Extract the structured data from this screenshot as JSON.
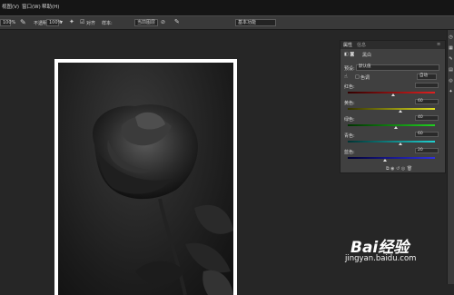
{
  "menubar": {
    "items": [
      "视图(V)",
      "窗口(W)",
      "帮助(H)"
    ]
  },
  "options_bar": {
    "zoom_value": "100%",
    "opacity_label": "不透明度:",
    "opacity_value": "100%",
    "flow_label": "流量:",
    "flow_value": "100%",
    "airbrush_label": "对齐",
    "sample_label": "样本:",
    "sample_value": "当前图层",
    "workspace_value": "基本功能"
  },
  "properties_panel": {
    "tabs": [
      "属性",
      "信息"
    ],
    "header_label": "黑白",
    "preset_label": "预设:",
    "preset_value": "默认值",
    "tint_label": "色调",
    "auto_label": "自动",
    "sliders": [
      {
        "label": "红色:",
        "value": "",
        "fill": 0.52
      },
      {
        "label": "黄色:",
        "value": "60",
        "fill": 0.6
      },
      {
        "label": "绿色:",
        "value": "40",
        "fill": 0.55
      },
      {
        "label": "青色:",
        "value": "60",
        "fill": 0.6
      },
      {
        "label": "蓝色:",
        "value": "20",
        "fill": 0.43
      }
    ]
  },
  "watermark": {
    "brand": "Bai经验",
    "url": "jingyan.baidu.com"
  },
  "colors": {
    "background": "#262626",
    "panel": "#404040",
    "menubar": "#151515"
  }
}
